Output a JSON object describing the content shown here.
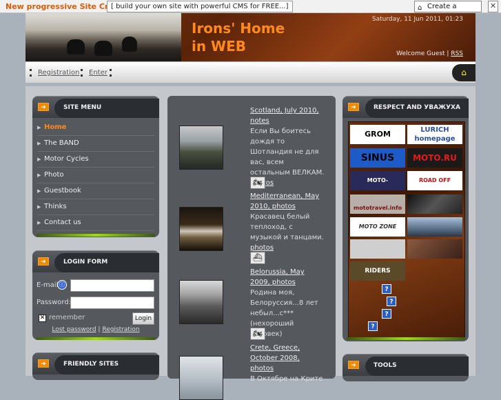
{
  "topbar": {
    "promo_title": "New progressive Site Creator",
    "promo_text": "[ build your own site with powerful CMS for FREE...]",
    "create_label": "Create a Website",
    "close_label": "✕"
  },
  "header": {
    "title_line1": "Irons' Home",
    "title_line2": "in WEB",
    "date": "Saturday, 11 Jun 2011, 01:23",
    "welcome": "Welcome Guest |",
    "rss": "RSS"
  },
  "nav": {
    "registration": "Registration",
    "enter": "Enter"
  },
  "site_menu": {
    "title": "SITE MENU",
    "items": [
      {
        "label": "Home"
      },
      {
        "label": "The BAND"
      },
      {
        "label": "Motor Cycles"
      },
      {
        "label": "Photo"
      },
      {
        "label": "Guestbook"
      },
      {
        "label": "Thinks"
      },
      {
        "label": "Contact us"
      }
    ]
  },
  "login": {
    "title": "LOGIN FORM",
    "email_label": "E-mail:",
    "password_label": "Password:",
    "remember_label": "remember",
    "login_button": "Login",
    "lost_password": "Lost password",
    "separator": "|",
    "registration": "Registration"
  },
  "friendly": {
    "title": "FRIENDLY SITES"
  },
  "news": [
    {
      "title": "Scotland, July 2010, notes",
      "text": "Если Вы боитесь дождя то Шотландия не для вас, всем остальным ВЕЛКАМ.",
      "link": "photos"
    },
    {
      "title": "Mediterranean, May 2010, photos",
      "text": "Красавец белый теплоход, с музыкой и танцами.",
      "link": "photos"
    },
    {
      "title": "Belorussia, May 2009, photos",
      "text": "Родина моя, Белоруссия...8 лет небыл...с***(нехороший человек)",
      "link": ""
    },
    {
      "title": "Crete, Greece, October 2008, photos",
      "text": "В Октябре на Крите",
      "link": ""
    }
  ],
  "respect": {
    "title": "RESPECT AND УВАЖУХА",
    "banners": [
      {
        "text": "GROM",
        "bg": "#ffffff",
        "fg": "#000000"
      },
      {
        "text": "LURICH homepage",
        "bg": "#ffffff",
        "fg": "#2a4fa8"
      },
      {
        "text": "SINUS",
        "bg": "#1d5bc8",
        "fg": "#000000"
      },
      {
        "text": "MOTO.RU",
        "bg": "#1a1a1a",
        "fg": "#e61a1a"
      },
      {
        "text": "MOTO-TRAVELS.RU",
        "bg": "#2a2a5a",
        "fg": "#ffffff"
      },
      {
        "text": "ROAD OFF PEOPLE",
        "bg": "#ffffff",
        "fg": "#c01010"
      },
      {
        "text": "mototravel.info",
        "bg": "#b8b0a8",
        "fg": "#7a1010"
      },
      {
        "text": "",
        "bg": "#3a3a3a",
        "fg": "#ffffff"
      },
      {
        "text": "MOTO ZONE",
        "bg": "#ffffff",
        "fg": "#333333"
      },
      {
        "text": "",
        "bg": "#5a7088",
        "fg": "#ffffff"
      },
      {
        "text": "",
        "bg": "#cfcfcf",
        "fg": "#000000"
      },
      {
        "text": "",
        "bg": "#6a4030",
        "fg": "#ffffff"
      },
      {
        "text": "RIDERS",
        "bg": "#5b4a2a",
        "fg": "#ffffff"
      }
    ]
  },
  "tools": {
    "title": "TOOLS"
  },
  "colors": {
    "accent_orange": "#ff8a1a",
    "promo_orange": "#e05a00",
    "box_bg": "#55595e"
  }
}
